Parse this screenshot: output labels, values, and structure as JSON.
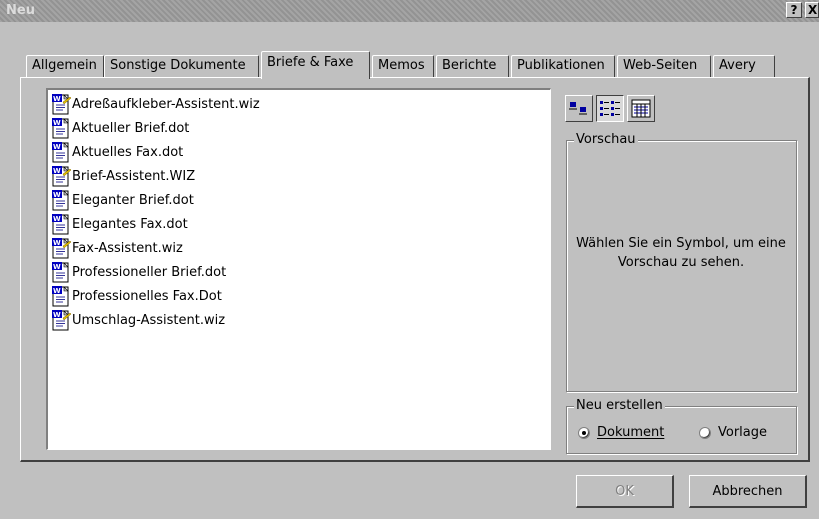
{
  "window": {
    "title": "Neu",
    "help_button": "?",
    "close_button": "X"
  },
  "tabs": [
    {
      "label": "Allgemein",
      "active": false
    },
    {
      "label": "Sonstige Dokumente",
      "active": false
    },
    {
      "label": "Briefe & Faxe",
      "active": true
    },
    {
      "label": "Memos",
      "active": false
    },
    {
      "label": "Berichte",
      "active": false
    },
    {
      "label": "Publikationen",
      "active": false
    },
    {
      "label": "Web-Seiten",
      "active": false
    },
    {
      "label": "Avery",
      "active": false
    }
  ],
  "files": [
    {
      "name": "Adreßaufkleber-Assistent.wiz",
      "icon": "wizard-doc-icon"
    },
    {
      "name": "Aktueller Brief.dot",
      "icon": "word-template-icon"
    },
    {
      "name": "Aktuelles Fax.dot",
      "icon": "word-template-icon"
    },
    {
      "name": "Brief-Assistent.WIZ",
      "icon": "wizard-doc-icon"
    },
    {
      "name": "Eleganter Brief.dot",
      "icon": "word-template-icon"
    },
    {
      "name": "Elegantes Fax.dot",
      "icon": "word-template-icon"
    },
    {
      "name": "Fax-Assistent.wiz",
      "icon": "wizard-doc-icon"
    },
    {
      "name": "Professioneller Brief.dot",
      "icon": "word-template-icon"
    },
    {
      "name": "Professionelles Fax.Dot",
      "icon": "word-template-icon"
    },
    {
      "name": "Umschlag-Assistent.wiz",
      "icon": "wizard-doc-icon"
    }
  ],
  "view_buttons": [
    {
      "name": "large-icons-view",
      "pressed": false
    },
    {
      "name": "list-view",
      "pressed": true
    },
    {
      "name": "details-view",
      "pressed": false
    }
  ],
  "preview": {
    "legend": "Vorschau",
    "message": "Wählen Sie ein Symbol, um eine Vorschau zu sehen."
  },
  "create_new": {
    "legend": "Neu erstellen",
    "options": [
      {
        "label": "Dokument",
        "selected": true
      },
      {
        "label": "Vorlage",
        "selected": false
      }
    ]
  },
  "buttons": {
    "ok": "OK",
    "cancel": "Abbrechen"
  }
}
